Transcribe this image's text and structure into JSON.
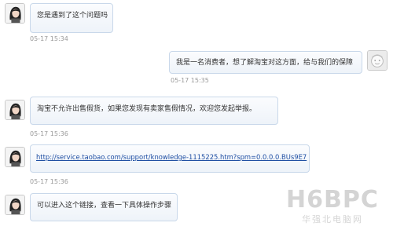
{
  "messages": [
    {
      "side": "left",
      "avatar": "user-avatar",
      "text": "您是遇到了这个问题吗",
      "time": "05-17 15:34"
    },
    {
      "side": "right",
      "avatar": "self-avatar",
      "text": "我是一名消费者，想了解淘宝对这方面，给与我们的保障",
      "time": "05-17 15:35"
    },
    {
      "side": "left",
      "avatar": "user-avatar",
      "text": "淘宝不允许出售假货，如果您发现有卖家售假情况，欢迎您发起举报。",
      "time": "05-17 15:36"
    },
    {
      "side": "left",
      "avatar": "user-avatar",
      "text": "http://service.taobao.com/support/knowledge-1115225.htm?spm=0.0.0.0.BUs9E7",
      "time": "05-17 15:36",
      "is_link": true
    },
    {
      "side": "left",
      "avatar": "user-avatar",
      "text": "可以进入这个链接，查看一下具体操作步骤",
      "time": "05-17 15:36"
    }
  ],
  "watermark": {
    "logo": "H6BPC",
    "sub": "华强北电脑网"
  }
}
